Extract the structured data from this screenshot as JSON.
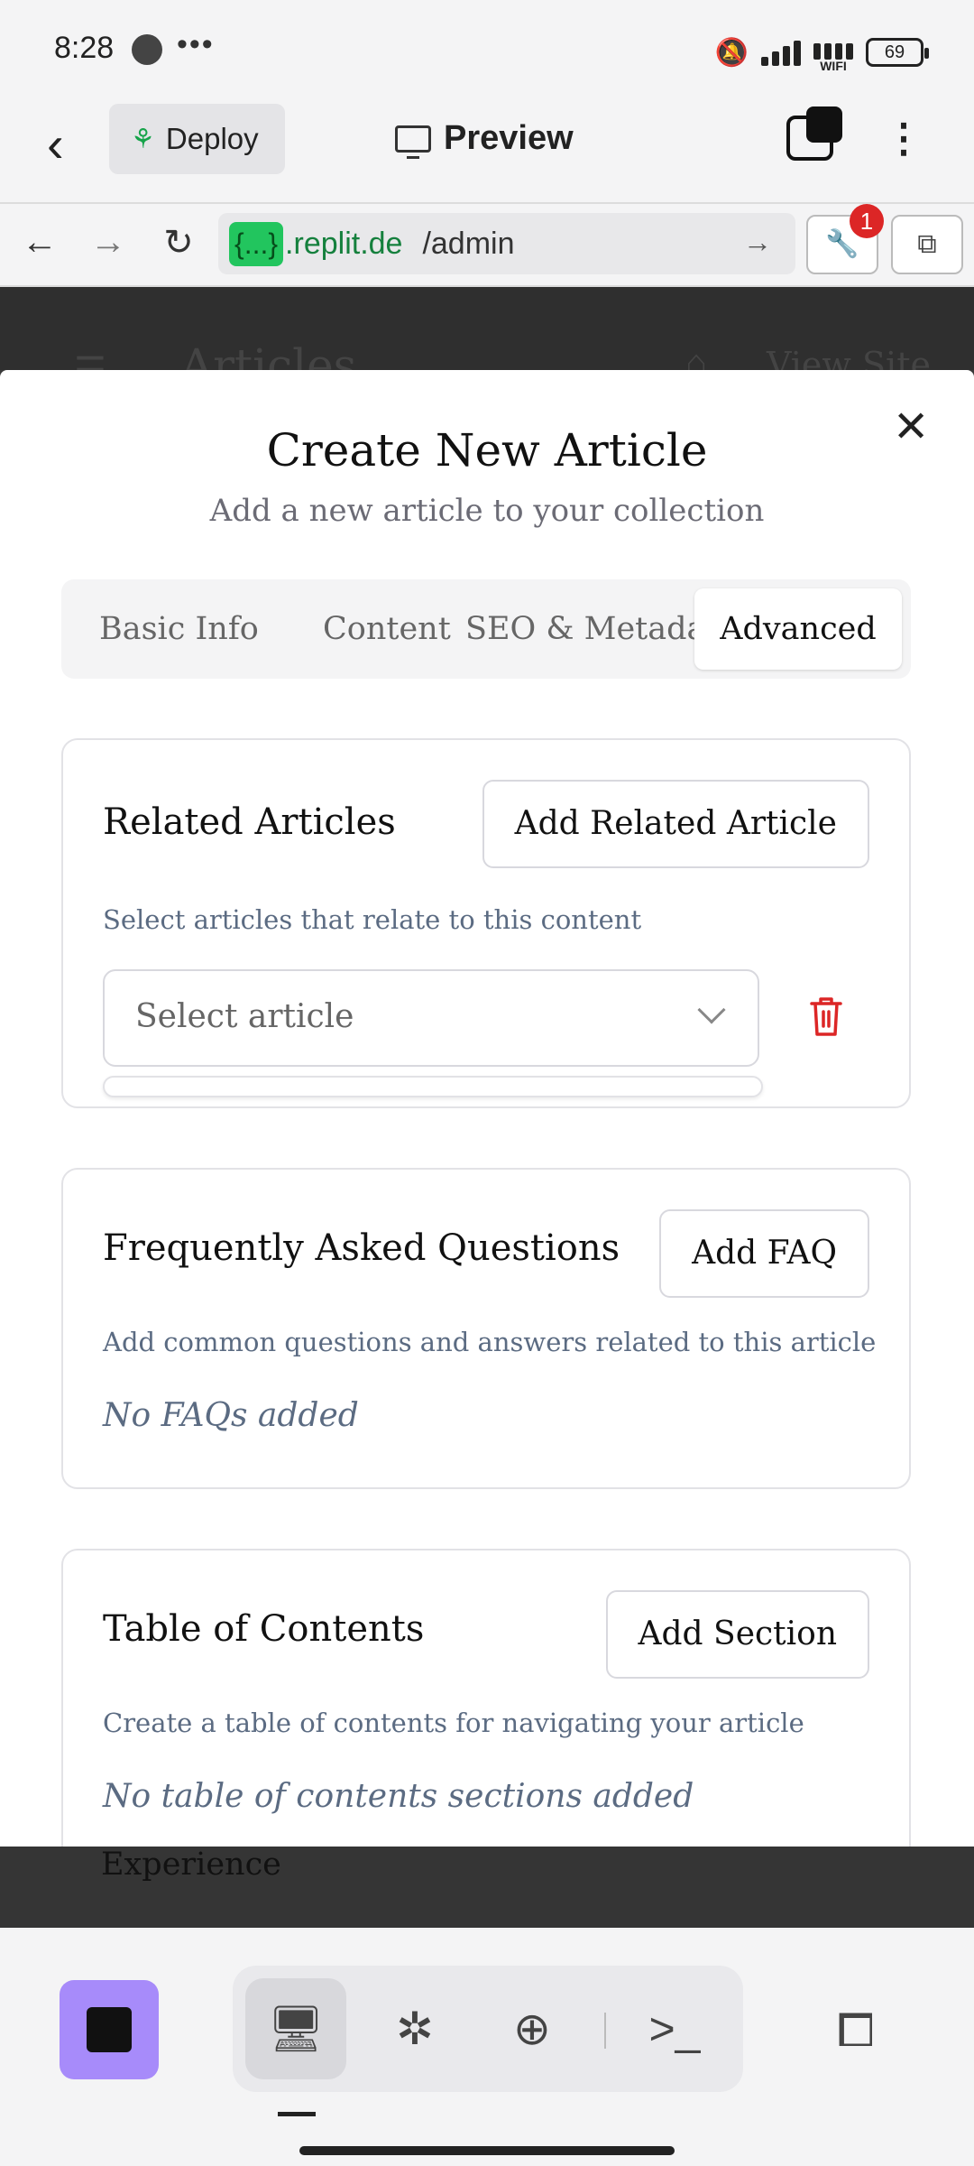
{
  "status_bar": {
    "time": "8:28",
    "wifi_label": "WIFI",
    "battery": "69"
  },
  "app_header": {
    "deploy_label": "Deploy",
    "preview_label": "Preview"
  },
  "url_bar": {
    "host_tag": "{...}",
    "host": ".replit.de",
    "path": "/admin",
    "notification_count": "1"
  },
  "background_page": {
    "title": "Articles",
    "view_site": "View Site"
  },
  "modal": {
    "title": "Create New Article",
    "subtitle": "Add a new article to your collection",
    "tabs": [
      {
        "label": "Basic Info"
      },
      {
        "label": "Content"
      },
      {
        "label": "SEO & Metadat"
      },
      {
        "label": "Advanced"
      }
    ],
    "related": {
      "title": "Related Articles",
      "button": "Add Related Article",
      "description": "Select articles that relate to this content",
      "select_placeholder": "Select article"
    },
    "faq": {
      "title": "Frequently Asked Questions",
      "button": "Add FAQ",
      "description": "Add common questions and answers related to this article",
      "empty": "No FAQs added"
    },
    "toc": {
      "title": "Table of Contents",
      "button": "Add Section",
      "description": "Create a table of contents for navigating your article",
      "empty": "No table of contents sections added"
    },
    "next_section_peek": "Experience"
  },
  "colors": {
    "accent_purple": "#a78bfa",
    "danger_red": "#dc2626",
    "url_green": "#22c55e"
  }
}
